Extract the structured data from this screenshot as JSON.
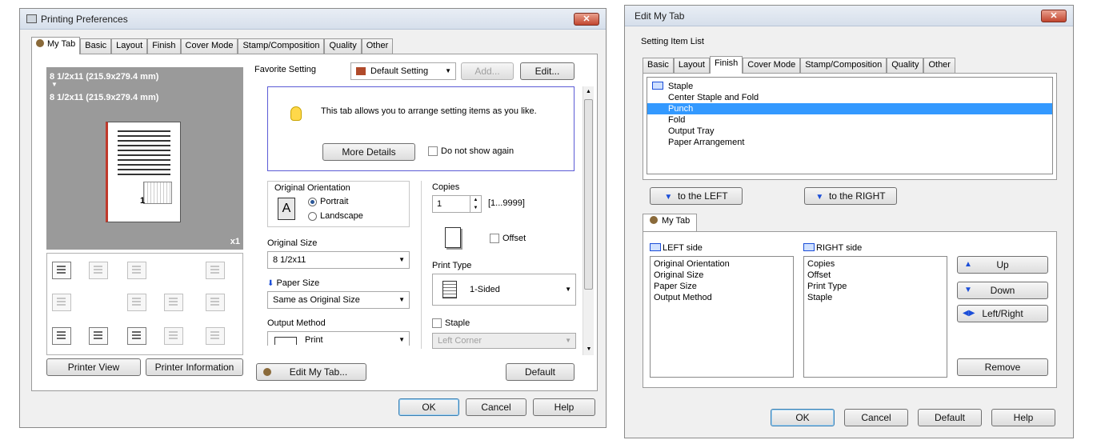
{
  "window1": {
    "title": "Printing Preferences",
    "close": "✕",
    "tabs": [
      "My Tab",
      "Basic",
      "Layout",
      "Finish",
      "Cover Mode",
      "Stamp/Composition",
      "Quality",
      "Other"
    ],
    "preview": {
      "size_line1": "8 1/2x11 (215.9x279.4 mm)",
      "arrow": "▼",
      "size_line2": "8 1/2x11 (215.9x279.4 mm)",
      "page_number": "1",
      "copies_mark": "x1"
    },
    "printer_view_btn": "Printer View",
    "printer_info_btn": "Printer Information",
    "favorite_label": "Favorite Setting",
    "favorite_value": "Default Setting",
    "add_btn": "Add...",
    "edit_btn": "Edit...",
    "info": {
      "text": "This tab allows you to arrange setting items as you like.",
      "more_details": "More Details",
      "do_not_show": "Do not show again"
    },
    "orientation": {
      "label": "Original Orientation",
      "portrait": "Portrait",
      "landscape": "Landscape",
      "glyph": "A"
    },
    "original_size": {
      "label": "Original Size",
      "value": "8 1/2x11"
    },
    "paper_size": {
      "label": "Paper Size",
      "value": "Same as Original Size"
    },
    "output_method": {
      "label": "Output Method",
      "value": "Print"
    },
    "copies": {
      "label": "Copies",
      "value": "1",
      "range": "[1...9999]",
      "offset": "Offset"
    },
    "print_type": {
      "label": "Print Type",
      "value": "1-Sided"
    },
    "staple": {
      "label": "Staple",
      "value": "Left Corner"
    },
    "edit_my_tab_btn": "Edit My Tab...",
    "default_btn": "Default",
    "ok": "OK",
    "cancel": "Cancel",
    "help": "Help"
  },
  "window2": {
    "title": "Edit My Tab",
    "close": "✕",
    "setting_item_list": "Setting Item List",
    "tabs": [
      "Basic",
      "Layout",
      "Finish",
      "Cover Mode",
      "Stamp/Composition",
      "Quality",
      "Other"
    ],
    "items": [
      "Staple",
      "Center Staple and Fold",
      "Punch",
      "Fold",
      "Output Tray",
      "Paper Arrangement"
    ],
    "selected_item": "Punch",
    "to_left": "to the LEFT",
    "to_right": "to the RIGHT",
    "my_tab": "My Tab",
    "left_side": {
      "label": "LEFT side",
      "items": [
        "Original Orientation",
        "Original Size",
        "Paper Size",
        "Output Method"
      ]
    },
    "right_side": {
      "label": "RIGHT side",
      "items": [
        "Copies",
        "Offset",
        "Print Type",
        "Staple"
      ]
    },
    "up": "Up",
    "down": "Down",
    "left_right": "Left/Right",
    "remove": "Remove",
    "ok": "OK",
    "cancel": "Cancel",
    "default": "Default",
    "help": "Help"
  },
  "colors": {
    "selection": "#3399ff",
    "info_border": "#5b5bd6",
    "preview_bg": "#9a9a9a",
    "accent_blue": "#1b4ed8"
  }
}
